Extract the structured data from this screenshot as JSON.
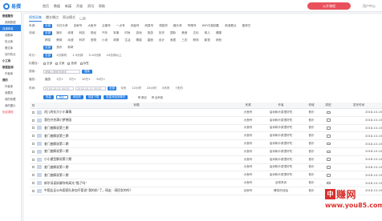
{
  "header": {
    "logo_text": "易撰",
    "nav": [
      "首页",
      "数据",
      "新媒",
      "开放",
      "资讯",
      "帮助"
    ],
    "open_button": "公开课程",
    "user": "用户中心"
  },
  "sidebar": [
    {
      "label": "数据服务",
      "type": "group"
    },
    {
      "label": "视频数据",
      "type": "sub"
    },
    {
      "label": "自媒体库",
      "type": "active"
    },
    {
      "label": "选题库",
      "type": "sub"
    },
    {
      "label": "热点库",
      "type": "sub"
    },
    {
      "label": "爆文库",
      "type": "sub"
    },
    {
      "label": "实时热点",
      "type": "sub"
    },
    {
      "label": "小工具",
      "type": "group"
    },
    {
      "label": "数据监测",
      "type": "group"
    },
    {
      "label": "作者库",
      "type": "sub"
    },
    {
      "label": "我的",
      "type": "group"
    },
    {
      "label": "作者库",
      "type": "sub"
    },
    {
      "label": "收藏夹",
      "type": "sub"
    },
    {
      "label": "我的收藏",
      "type": "sub"
    },
    {
      "label": "我的图片",
      "type": "sub"
    },
    {
      "label": "免费课程",
      "type": "red"
    }
  ],
  "tabs": {
    "t1": "视频采集",
    "t2": "爆文爆点",
    "t3": "简洁模式"
  },
  "filters": {
    "platform": {
      "label": "来源：",
      "options": [
        "全部",
        "今日头条",
        "百家号",
        "大鱼号",
        "企鹅号",
        "一点号",
        "凤凰号",
        "网易号",
        "搜狐号",
        "趣头条",
        "哔哩号",
        "WiFi万能钥匙",
        "新浪看点",
        "爱奇艺"
      ]
    },
    "domain": {
      "label": "领域：",
      "row1": [
        "全部",
        "娱乐",
        "体育",
        "科技",
        "财经",
        "汽车",
        "军事",
        "时尚",
        "游戏",
        "旅游",
        "历史",
        "国际",
        "美食",
        "文化",
        "育儿",
        "健康"
      ],
      "row2": [
        "搞笑",
        "教育",
        "动漫",
        "科学",
        "宠物",
        "小说",
        "母婴",
        "生活",
        "情感",
        "星座",
        "设计",
        "家居",
        "三农",
        "职场",
        "影视",
        "其他"
      ],
      "row3": [
        "全部",
        "资讯",
        "新奇"
      ]
    },
    "duration": {
      "label": "时长：",
      "options": [
        "全部",
        "1分钟内",
        "1-3分钟",
        "3-10分钟",
        "10分钟以上"
      ]
    },
    "keyword": {
      "label": "标题含：",
      "options": [
        "全部",
        "文案",
        "音频",
        "标签"
      ]
    },
    "search": {
      "label": "搜索：",
      "placeholder": "请输入搜索关键字",
      "btn": "搜索"
    },
    "views": {
      "label": "播放：",
      "options": [
        "播放",
        "1万+",
        "5万+",
        "10万+",
        "50万+"
      ]
    },
    "time": {
      "label": "时间：",
      "start": "2018-10-01 00:00",
      "end": "2018-10-11 00:00",
      "options": [
        "全部",
        "今天",
        "12小时",
        "24小时",
        "3天内",
        "7天内"
      ]
    },
    "actions": {
      "b1": "批量",
      "b2": "导出",
      "b3": "添加到",
      "b4": "批量下载",
      "b5": "批量添加到素材",
      "r1": "原创",
      "r2": "全声音"
    }
  },
  "table": {
    "headers": {
      "title": "标题",
      "source": "来源",
      "author": "作者",
      "domain": "领域",
      "type": "类型",
      "time": "发布时间"
    },
    "rows": [
      {
        "title": "花儿的长大小小事情",
        "source": "大鱼号",
        "author": "油米和炒菜很好吃",
        "domain": "音乐",
        "time": "2018-10-10"
      },
      {
        "title": "我在外充满小梦想画",
        "source": "大鱼号",
        "author": "油米和炒菜很好吃",
        "domain": "音乐",
        "time": "2018-10-10"
      },
      {
        "title": "查门曲解说第三期",
        "source": "大鱼号",
        "author": "油米和炒菜很好吃",
        "domain": "音乐",
        "time": "2018-10-10"
      },
      {
        "title": "查门曲解说第三期",
        "source": "大鱼号",
        "author": "油米和炒菜很好吃",
        "domain": "音乐",
        "time": "2018-10-10"
      },
      {
        "title": "查门曲解说第二期",
        "source": "大鱼号",
        "author": "油米和炒菜很好吃",
        "domain": "音乐",
        "time": "2018-10-10"
      },
      {
        "title": "查门曲解说第二期",
        "source": "大鱼号",
        "author": "油米和炒菜很好吃",
        "domain": "音乐",
        "time": "2018-10-10"
      },
      {
        "title": "小小建型解说第六期",
        "source": "大鱼号",
        "author": "油米和炒菜很好吃",
        "domain": "音乐",
        "time": "2018-10-10"
      },
      {
        "title": "查门曲解说第二期",
        "source": "大鱼号",
        "author": "油米和炒菜很好吃",
        "domain": "音乐",
        "time": "2018-10-10"
      },
      {
        "title": "查门曲解说第二期",
        "source": "大鱼号",
        "author": "油米和炒菜很好吃",
        "domain": "音乐",
        "time": "2018-10-10"
      },
      {
        "title": "新华深读拆解你的高光“猫了吗”",
        "source": "大鱼号",
        "author": "全球风尚",
        "domain": "音乐",
        "time": "2018-10-10"
      },
      {
        "title": "中国女足公布国家队参加不管说“我的妈”了，网友：网民发的吗？",
        "source": "百家号",
        "author": "爆笑的创始",
        "domain": "音乐",
        "time": "2018-10-10"
      }
    ]
  },
  "watermark": {
    "box": "中",
    "brand": "赚网",
    "url": "www.you85.com"
  }
}
